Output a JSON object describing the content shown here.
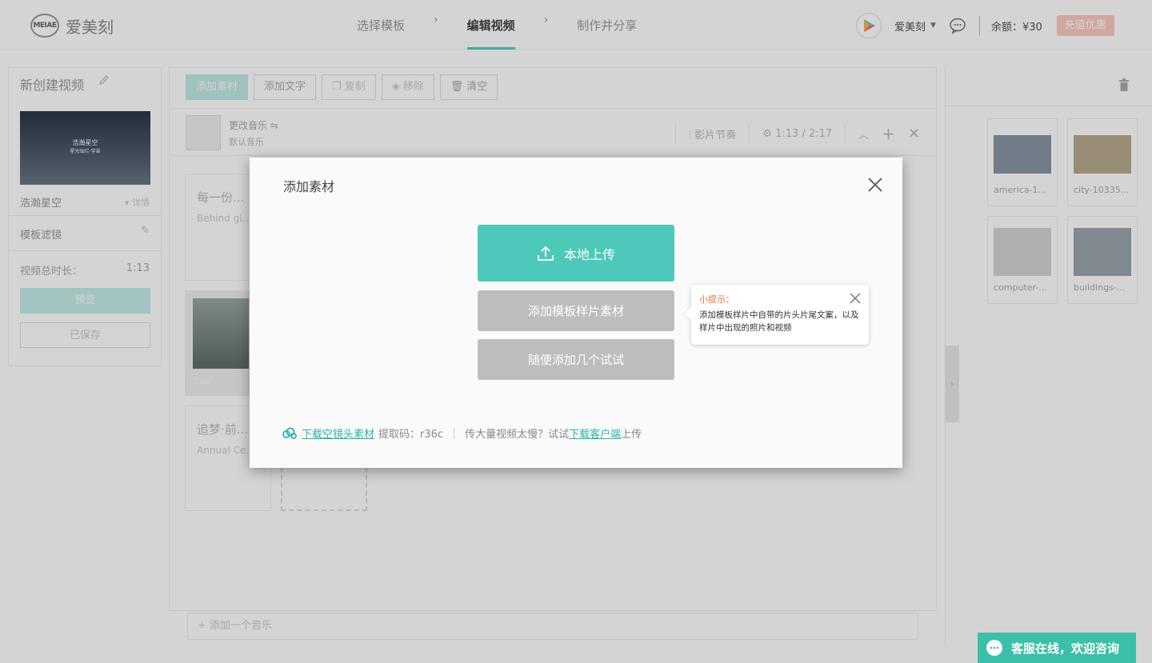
{
  "header": {
    "logo_mark": "MEIAE",
    "logo_text": "爱美刻",
    "steps": [
      "选择模板",
      "编辑视频",
      "制作并分享"
    ],
    "step_arrow": "›",
    "user_name": "爱美刻",
    "balance": "余额：¥30",
    "recharge_label": "充值优惠"
  },
  "left_panel": {
    "project_title": "新创建视频",
    "thumb_title": "浩瀚星空",
    "thumb_sub": "星光灿烂·宇宙",
    "template_name": "浩瀚星空",
    "template_detail": "详情",
    "filter_label": "模板滤镜",
    "duration_label": "视频总时长：",
    "duration_value": "1:13",
    "preview_label": "预览",
    "saved_label": "已保存"
  },
  "center": {
    "toolbar": {
      "add_material": "添加素材",
      "add_text": "添加文字",
      "copy": "复制",
      "remove": "移除",
      "clear": "清空"
    },
    "music": {
      "title": "更改音乐",
      "subtitle": "默认音乐",
      "rhythm": "影片节奏",
      "time": "1:13 / 2:17"
    },
    "cards": [
      {
        "title": "每一份...",
        "subtitle": "Behind gl..."
      },
      {
        "title": "追梦·前...",
        "subtitle": "Annual Ce..."
      }
    ],
    "clip_time": "3.6s",
    "add_music": "+ 添加一个音乐"
  },
  "right_panel": {
    "assets": [
      {
        "name": "america-1...",
        "color": "#8a96a4"
      },
      {
        "name": "city-10335...",
        "color": "#b8a98c"
      },
      {
        "name": "computer-...",
        "color": "#d4d4d4"
      },
      {
        "name": "buildings-...",
        "color": "#9aa4ae"
      }
    ]
  },
  "modal": {
    "title": "添加素材",
    "upload_label": "本地上传",
    "template_sample_label": "添加模板样片素材",
    "random_label": "随便添加几个试试",
    "tip_title": "小提示：",
    "tip_body": "添加模板样片中自带的片头片尾文案，以及样片中出现的照片和视频",
    "footer": {
      "download_link": "下载空镜头素材",
      "password": "提取码：r36c",
      "slow_text": "传大量视频太慢？试试",
      "client_link": "下载客户端",
      "upload_suffix": "上传"
    }
  },
  "chat_widget": {
    "label": "客服在线，欢迎咨询"
  },
  "colors": {
    "accent": "#4ec9b9",
    "tip_title": "#e8703a",
    "gray_button": "#bdbdbd"
  }
}
